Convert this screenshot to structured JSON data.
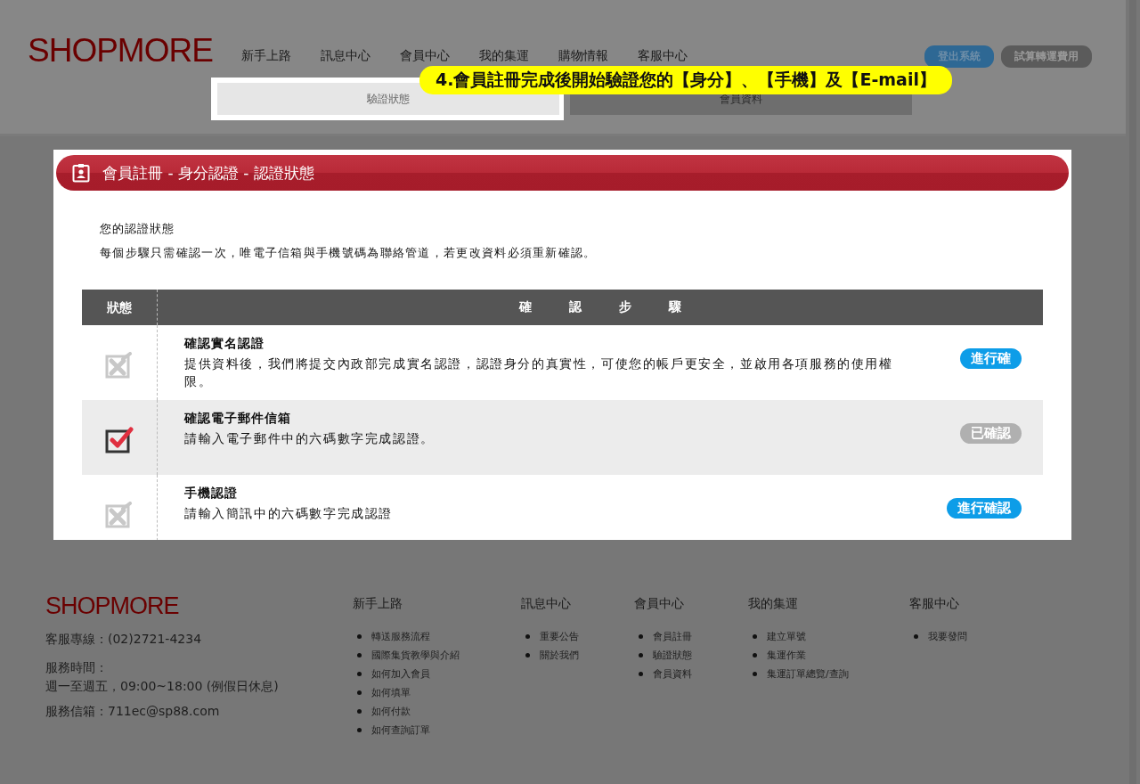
{
  "header": {
    "logo": "SHOPMORE",
    "nav": [
      "新手上路",
      "訊息中心",
      "會員中心",
      "我的集運",
      "購物情報",
      "客服中心"
    ],
    "buttons": [
      {
        "label": "登出系統",
        "kind": "primary"
      },
      {
        "label": "試算轉運費用",
        "kind": "secondary"
      }
    ],
    "tabs": [
      {
        "label": "驗證狀態",
        "selected": true
      },
      {
        "label": "會員資料",
        "selected": false
      }
    ]
  },
  "callout": "4.會員註冊完成後開始驗證您的【身分】、【手機】及【E-mail】",
  "panel": {
    "title": "會員註冊 - 身分認證 - 認證狀態",
    "heading": "您的認證狀態",
    "note": "每個步驟只需確認一次，唯電子信箱與手機號碼為聯絡管道，若更改資料必須重新確認。",
    "columns": [
      "狀態",
      "確　　　認　　　步　　　驟"
    ],
    "rows": [
      {
        "checked": false,
        "title": "確認實名認證",
        "desc": "提供資料後，我們將提交內政部完成實名認證，認證身分的真實性，可使您的帳戶更安全，並啟用各項服務的使用權限。",
        "button": {
          "label": "進行確",
          "kind": "action"
        }
      },
      {
        "checked": true,
        "title": "確認電子郵件信箱",
        "desc": "請輸入電子郵件中的六碼數字完成認證。",
        "button": {
          "label": "已確認",
          "kind": "done"
        }
      },
      {
        "checked": false,
        "title": "手機認證",
        "desc": "請輸入簡訊中的六碼數字完成認證",
        "button": {
          "label": "進行確認",
          "kind": "action"
        }
      }
    ]
  },
  "footer": {
    "logo": "SHOPMORE",
    "contacts": [
      "客服專線：(02)2721-4234",
      "服務時間：",
      "週一至週五，09:00~18:00 (例假日休息)",
      "服務信箱：711ec@sp88.com"
    ],
    "columns": [
      {
        "title": "新手上路",
        "links": [
          "轉送服務流程",
          "國際集貨教學與介紹",
          "如何加入會員",
          "如何填單",
          "如何付款",
          "如何查詢訂單"
        ]
      },
      {
        "title": "訊息中心",
        "links": [
          "重要公告",
          "關於我們"
        ]
      },
      {
        "title": "會員中心",
        "links": [
          "會員註冊",
          "驗證狀態",
          "會員資料"
        ]
      },
      {
        "title": "我的集運",
        "links": [
          "建立單號",
          "集運作業",
          "集運訂單總覽/查詢"
        ]
      },
      {
        "title": "客服中心",
        "links": [
          "我要發問"
        ]
      }
    ]
  }
}
